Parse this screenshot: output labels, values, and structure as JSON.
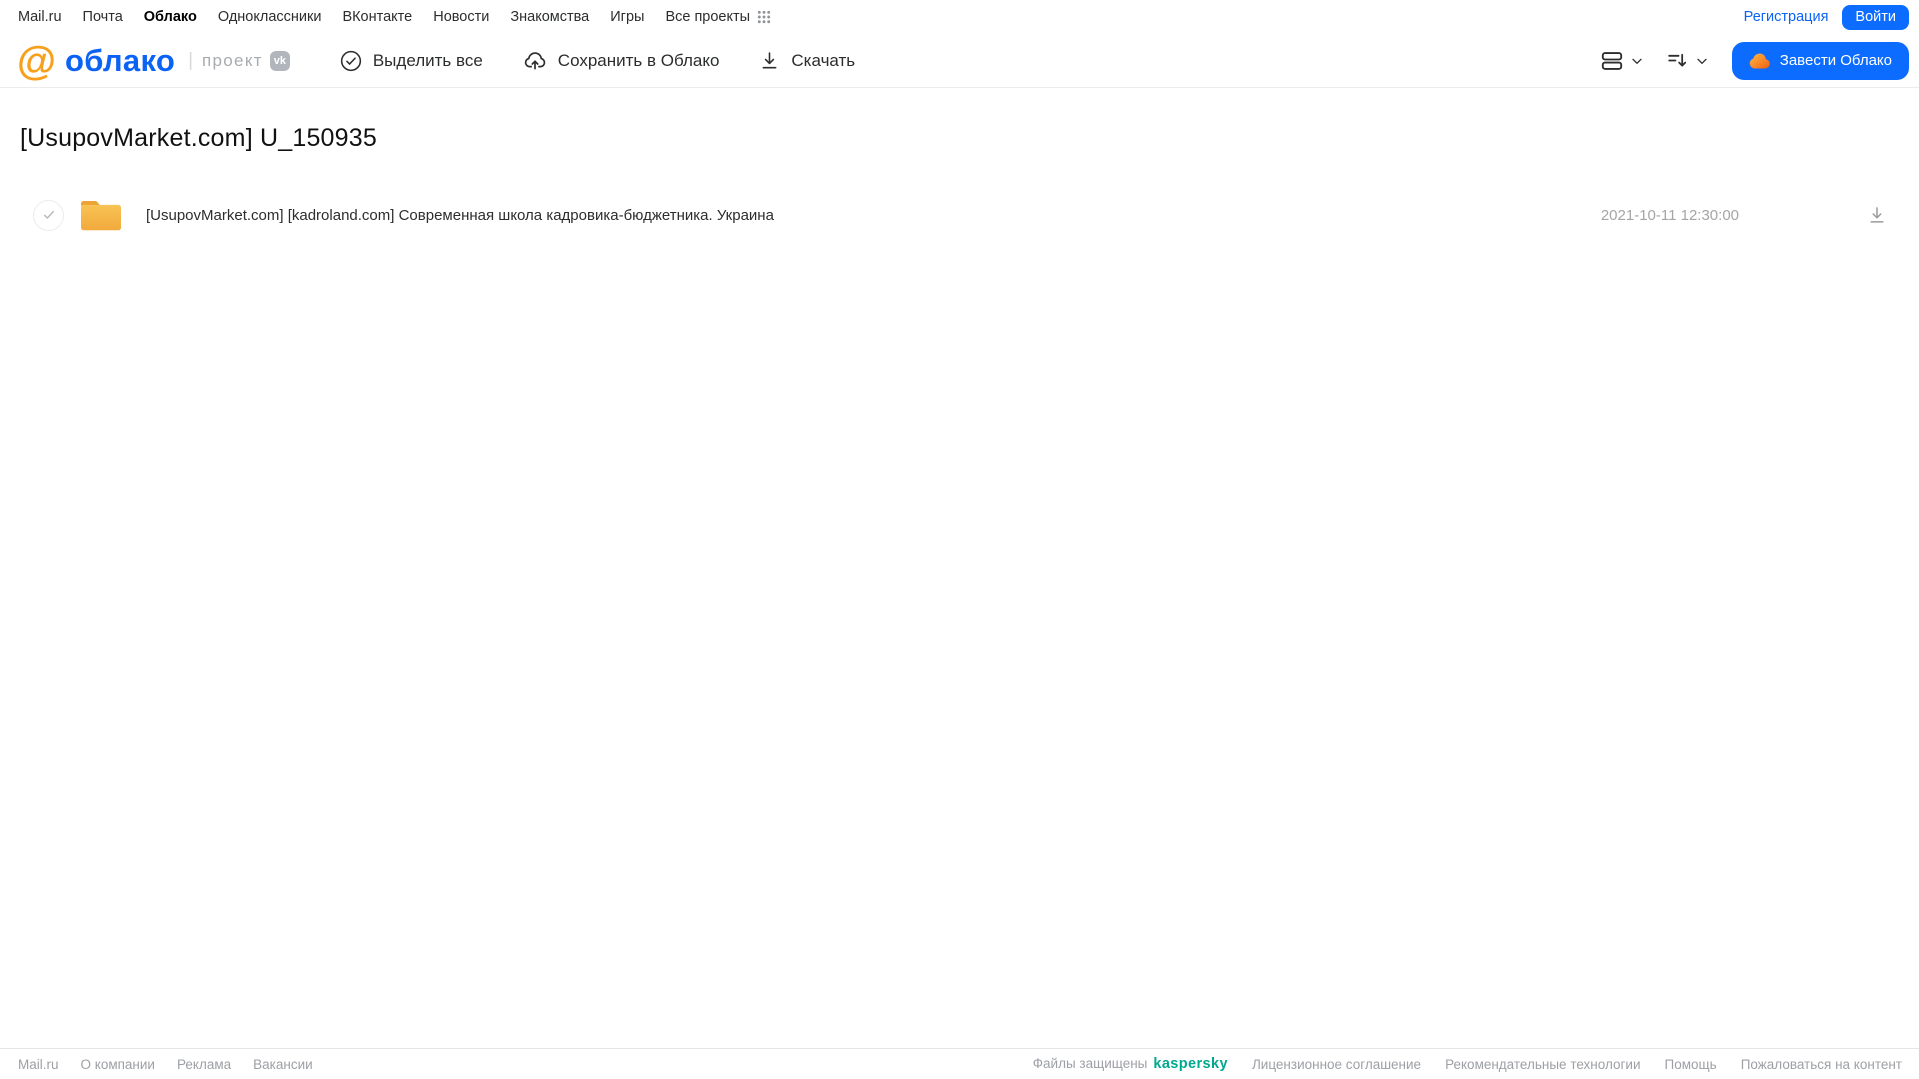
{
  "topnav": {
    "items": [
      {
        "label": "Mail.ru"
      },
      {
        "label": "Почта"
      },
      {
        "label": "Облако",
        "active": true
      },
      {
        "label": "Одноклассники"
      },
      {
        "label": "ВКонтакте"
      },
      {
        "label": "Новости"
      },
      {
        "label": "Знакомства"
      },
      {
        "label": "Игры"
      },
      {
        "label": "Все проекты"
      }
    ],
    "registration_label": "Регистрация",
    "login_label": "Войти"
  },
  "header": {
    "logo": {
      "at": "@",
      "name": "облако",
      "divider": "|",
      "project": "проект",
      "vk": "vk"
    },
    "toolbar": {
      "select_all": "Выделить все",
      "save_to_cloud": "Сохранить в Облако",
      "download": "Скачать"
    },
    "create_cloud_label": "Завести Облако"
  },
  "page": {
    "title": "[UsupovMarket.com] U_150935"
  },
  "files": [
    {
      "name": "[UsupovMarket.com] [kadroland.com] Современная школа кадровика-бюджетника. Украина",
      "date": "2021-10-11 12:30:00"
    }
  ],
  "footer": {
    "links_left": [
      "Mail.ru",
      "О компании",
      "Реклама",
      "Вакансии"
    ],
    "protected_label": "Файлы защищены",
    "kaspersky_label": "kaspersky",
    "links_right": [
      "Лицензионное соглашение",
      "Рекомендательные технологии",
      "Помощь",
      "Пожаловаться на контент"
    ]
  },
  "icons": {
    "grid-icon": "3x3 dots",
    "check-circle-icon": "circle with checkmark",
    "cloud-upload-icon": "cloud with up arrow",
    "download-icon": "down arrow over baseline",
    "list-view-icon": "two stacked rows",
    "sort-icon": "lines with down arrow",
    "chevron-down-icon": "v chevron",
    "folder-icon": "yellow folder",
    "cloud-icon": "orange cloud blob",
    "checkbox-circle-icon": "gray circle with check"
  },
  "colors": {
    "accent_blue": "#0b6cff",
    "logo_blue": "#0b63f6",
    "logo_orange": "#f7a01d",
    "kaspersky_green": "#00a88e",
    "folder_yellow_top": "#eca436",
    "folder_yellow_body": "#f2a93c"
  }
}
